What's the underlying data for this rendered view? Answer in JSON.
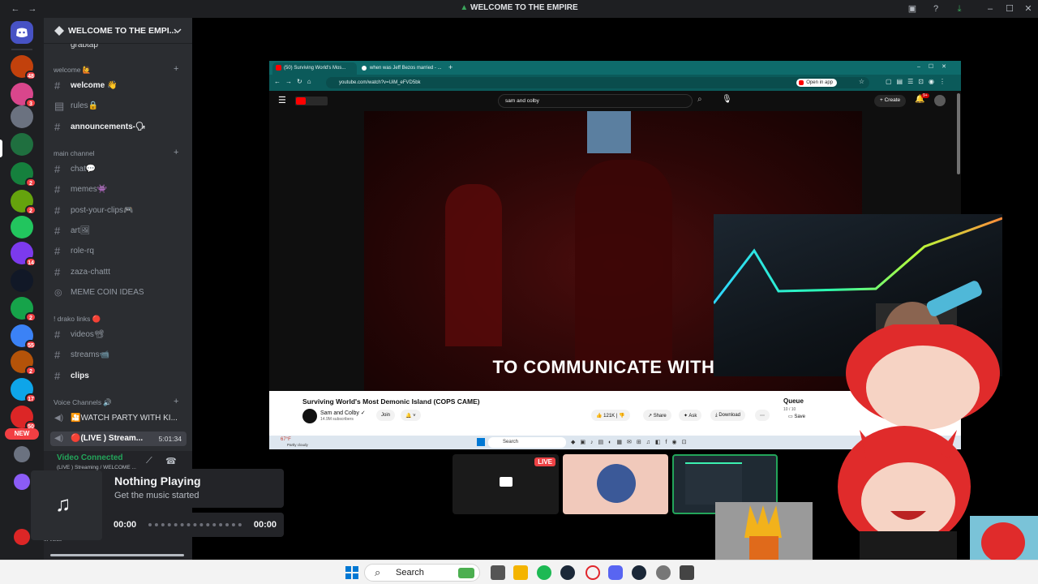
{
  "window": {
    "title": "WELCOME TO THE EMPIRE"
  },
  "servers": {
    "badges": [
      "48",
      "3",
      "2",
      "2",
      "14",
      "2",
      "55",
      "2",
      "17",
      "50"
    ],
    "new_label": "NEW"
  },
  "guild": {
    "name": "WELCOME TO THE EMPI...",
    "partial_channel": "grabtap",
    "categories": [
      "welcome 🙋",
      "main channel",
      "! drako links 🔴",
      "Voice Channels 🔊"
    ],
    "channels": {
      "welcome": "welcome 👋",
      "rules": "rules🔒",
      "announcements": "announcements-🗣",
      "chat": "chat💬",
      "memes": "memes👾",
      "post": "post-your-clips🎮",
      "art": "art🖼",
      "role": "role-rq",
      "zaza": "zaza-chattt",
      "meme_coin": "MEME COIN IDEAS",
      "videos": "videos📽",
      "streams": "streams📹",
      "clips": "clips",
      "watch_party": "🎦WATCH PARTY WITH KI...",
      "live_stream": "🔴(LIVE ) Stream...",
      "live_time": "5:01:34"
    },
    "voice_connected": "Video Connected",
    "voice_sub": "(LIVE ) Streaming / WELCOME ...",
    "in_voice": "In voice"
  },
  "now_playing": {
    "title": "Nothing Playing",
    "subtitle": "Get the music started",
    "time_start": "00:00",
    "time_end": "00:00"
  },
  "browser": {
    "tab1": "(50) Surviving World's Mos...",
    "tab2": "when was Jeff Bezos married - ...",
    "url": "youtube.com/watch?v=UiM_eFVD5bk",
    "open_in_app": "Open in app",
    "search_value": "sam and colby",
    "create_label": "Create",
    "notif_count": "9+"
  },
  "video": {
    "caption": "TO COMMUNICATE WITH U",
    "title": "Surviving World's Most Demonic Island (COPS CAME)",
    "channel": "Sam and Colby",
    "subscribers": "14.9M subscribers",
    "join": "Join",
    "likes": "121K",
    "share": "Share",
    "ask": "Ask",
    "download": "Download",
    "queue": "Queue",
    "queue_count": "10 / 10",
    "save": "Save",
    "weather_temp": "67°F",
    "weather_desc": "Partly cloudy",
    "inner_search": "Search"
  },
  "thumbs": {
    "live_badge": "LIVE"
  },
  "taskbar": {
    "search": "Search"
  }
}
